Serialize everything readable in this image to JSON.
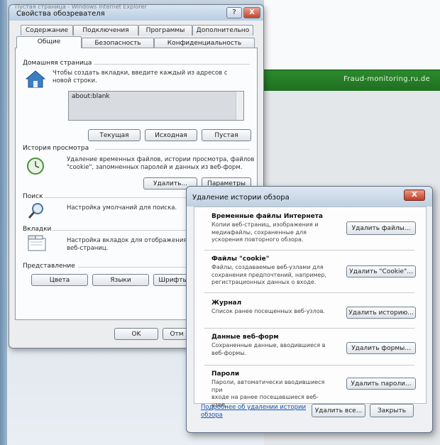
{
  "background": {
    "window_caption": "Пустая страница - Windows Internet Explorer",
    "green_bar_text": "Fraud-monitoring.ru.de"
  },
  "internet_options": {
    "title": "Свойства обозревателя",
    "help_button": "?",
    "close_button": "X",
    "tabs_row1": [
      "Содержание",
      "Подключения",
      "Программы",
      "Дополнительно"
    ],
    "tabs_row2": [
      "Общие",
      "Безопасность",
      "Конфиденциальность"
    ],
    "homepage": {
      "title": "Домашняя страница",
      "hint": [
        "Чтобы создать вкладки, введите каждый из адресов с",
        "новой строки."
      ],
      "value": "about:blank",
      "buttons": [
        "Текущая",
        "Исходная",
        "Пустая"
      ]
    },
    "history": {
      "title": "История просмотра",
      "text": [
        "Удаление временных файлов, истории просмотра, файлов",
        "\"cookie\", запомненных паролей и данных из веб-форм."
      ],
      "buttons": [
        "Удалить...",
        "Параметры"
      ]
    },
    "search": {
      "title": "Поиск",
      "text": "Настройка умолчаний для поиска."
    },
    "tabs_section": {
      "title": "Вкладки",
      "text": [
        "Настройка вкладок для отображения",
        "веб-страниц."
      ]
    },
    "appearance": {
      "title": "Представление",
      "buttons": [
        "Цвета",
        "Языки",
        "Шрифты"
      ]
    },
    "footer_buttons": [
      "OK",
      "Отм"
    ]
  },
  "delete_history": {
    "title": "Удаление истории обзора",
    "close_button": "X",
    "groups": [
      {
        "title": "Временные файлы Интернета",
        "text": [
          "Копии веб-страниц, изображения и",
          "медиафайлы, сохраненные для",
          "ускорения повторного обзора."
        ],
        "button": "Удалить файлы..."
      },
      {
        "title": "Файлы \"cookie\"",
        "text": [
          "Файлы, создаваемые веб-узлами для",
          "сохранения предпочтений, например,",
          "регистрационных данных о входе."
        ],
        "button": "Удалить \"Cookie\"..."
      },
      {
        "title": "Журнал",
        "text": [
          "Список ранее посещенных веб-узлов."
        ],
        "button": "Удалить историю..."
      },
      {
        "title": "Данные веб-форм",
        "text": [
          "Сохраненные данные, вводившиеся в",
          "веб-формы."
        ],
        "button": "Удалить формы..."
      },
      {
        "title": "Пароли",
        "text": [
          "Пароли, автоматически вводившиеся при",
          "входе на ранее посещавшиеся веб-узел."
        ],
        "button": "Удалить пароли..."
      }
    ],
    "link": [
      "Подробнее об удалении истории",
      "обзора"
    ],
    "footer_buttons": [
      "Удалить все...",
      "Закрыть"
    ]
  }
}
